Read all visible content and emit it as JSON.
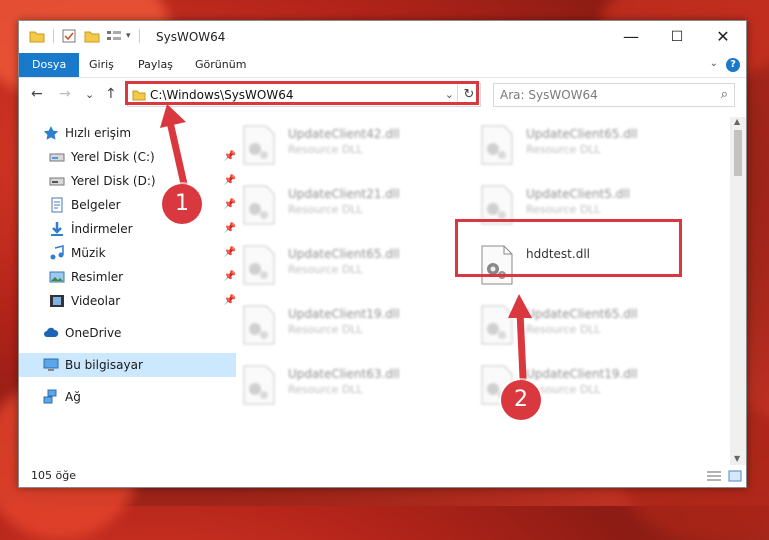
{
  "window": {
    "title": "SysWOW64",
    "minimize": "—",
    "maximize": "☐",
    "close": "✕"
  },
  "ribbon": {
    "tabs": [
      "Dosya",
      "Giriş",
      "Paylaş",
      "Görünüm"
    ],
    "help": "?",
    "expander": "⌄"
  },
  "navigation": {
    "back": "←",
    "forward": "→",
    "recent": "⌄",
    "up": "↑",
    "address": "C:\\Windows\\SysWOW64",
    "address_dropdown": "⌄",
    "refresh": "↻",
    "search_placeholder": "Ara: SysWOW64",
    "search_icon": "⌕"
  },
  "sidebar": {
    "items": [
      {
        "label": "Hızlı erişim",
        "icon": "star-icon"
      },
      {
        "label": "Yerel Disk (C:)",
        "icon": "drive-icon",
        "pinned": true
      },
      {
        "label": "Yerel Disk (D:)",
        "icon": "drive-icon",
        "pinned": true
      },
      {
        "label": "Belgeler",
        "icon": "documents-icon",
        "pinned": true
      },
      {
        "label": "İndirmeler",
        "icon": "downloads-icon",
        "pinned": true
      },
      {
        "label": "Müzik",
        "icon": "music-icon",
        "pinned": true
      },
      {
        "label": "Resimler",
        "icon": "pictures-icon",
        "pinned": true
      },
      {
        "label": "Videolar",
        "icon": "videos-icon",
        "pinned": true
      },
      {
        "label": "OneDrive",
        "icon": "cloud-icon"
      },
      {
        "label": "Bu bilgisayar",
        "icon": "computer-icon",
        "selected": true
      },
      {
        "label": "Ağ",
        "icon": "network-icon"
      }
    ]
  },
  "files": [
    {
      "name": "UpdateClient42.dll",
      "type": "Resource DLL"
    },
    {
      "name": "UpdateClient65.dll",
      "type": "Resource DLL"
    },
    {
      "name": "UpdateClient21.dll",
      "type": "Resource DLL"
    },
    {
      "name": "UpdateClient5.dll",
      "type": "Resource DLL"
    },
    {
      "name": "UpdateClient65.dll",
      "type": "Resource DLL"
    },
    {
      "name": "hddtest.dll",
      "type": ""
    },
    {
      "name": "UpdateClient19.dll",
      "type": "Resource DLL"
    },
    {
      "name": "UpdateClient65.dll",
      "type": "Resource DLL"
    },
    {
      "name": "UpdateClient63.dll",
      "type": "Resource DLL"
    },
    {
      "name": "UpdateClient19.dll",
      "type": "Resource DLL"
    }
  ],
  "status": {
    "count": "105 öğe"
  },
  "annotations": {
    "step1": "1",
    "step2": "2"
  },
  "colors": {
    "accent": "#1979ca",
    "highlight": "#d9393e",
    "selected": "#cce8ff"
  }
}
